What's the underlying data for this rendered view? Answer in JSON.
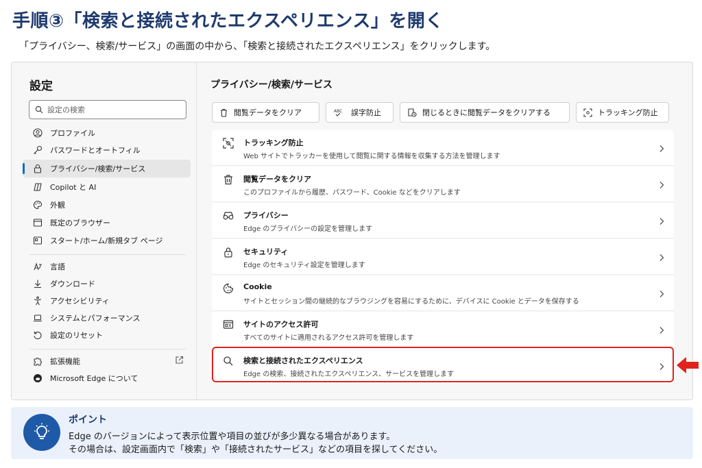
{
  "heading": {
    "title": "手順③「検索と接続されたエクスペリエンス」を開く",
    "subtitle": "「プライバシー、検索/サービス」の画面の中から、「検索と接続されたエクスペリエンス」をクリックします。"
  },
  "sidebar": {
    "title": "設定",
    "search_placeholder": "設定の検索",
    "items": [
      {
        "label": "プロファイル",
        "icon": "profile-icon"
      },
      {
        "label": "パスワードとオートフィル",
        "icon": "key-icon"
      },
      {
        "label": "プライバシー/検索/サービス",
        "icon": "lock-icon",
        "active": true
      },
      {
        "label": "Copilot と AI",
        "icon": "copilot-icon"
      },
      {
        "label": "外観",
        "icon": "palette-icon"
      },
      {
        "label": "既定のブラウザー",
        "icon": "browser-icon"
      },
      {
        "label": "スタート/ホーム/新規タブ ページ",
        "icon": "home-icon"
      },
      {
        "label": "言語",
        "icon": "language-icon"
      },
      {
        "label": "ダウンロード",
        "icon": "download-icon"
      },
      {
        "label": "アクセシビリティ",
        "icon": "accessibility-icon"
      },
      {
        "label": "システムとパフォーマンス",
        "icon": "laptop-icon"
      },
      {
        "label": "設定のリセット",
        "icon": "reset-icon"
      },
      {
        "label": "拡張機能",
        "icon": "puzzle-icon"
      },
      {
        "label": "Microsoft Edge について",
        "icon": "edge-icon"
      }
    ]
  },
  "main": {
    "title": "プライバシー/検索/サービス",
    "chips": [
      {
        "label": "閲覧データをクリア",
        "icon": "trash-icon"
      },
      {
        "label": "誤字防止",
        "icon": "spellcheck-icon"
      },
      {
        "label": "閉じるときに閲覧データをクリアする",
        "icon": "clear-on-close-icon"
      },
      {
        "label": "トラッキング防止",
        "icon": "tracking-icon"
      }
    ],
    "cards": [
      {
        "title": "トラッキング防止",
        "desc": "Web サイトでトラッカーを使用して閲覧に関する情報を収集する方法を管理します",
        "icon": "tracking-icon"
      },
      {
        "title": "閲覧データをクリア",
        "desc": "このプロファイルから履歴、パスワード、Cookie などをクリアします",
        "icon": "trash-icon"
      },
      {
        "title": "プライバシー",
        "desc": "Edge のプライバシーの設定を管理します",
        "icon": "glasses-icon"
      },
      {
        "title": "セキュリティ",
        "desc": "Edge のセキュリティ設定を管理します",
        "icon": "lock-icon"
      },
      {
        "title": "Cookie",
        "desc": "サイトとセッション間の継続的なブラウジングを容易にするために、デバイスに Cookie とデータを保存する",
        "icon": "cookie-icon"
      },
      {
        "title": "サイトのアクセス許可",
        "desc": "すべてのサイトに適用されるアクセス許可を管理します",
        "icon": "site-permissions-icon"
      },
      {
        "title": "検索と接続されたエクスペリエンス",
        "desc": "Edge の検索、接続されたエクスペリエンス、サービスを管理します",
        "icon": "search-icon"
      }
    ]
  },
  "tip": {
    "heading": "ポイント",
    "line1": "Edge のバージョンによって表示位置や項目の並びが多少異なる場合があります。",
    "line2": "その場合は、設定画面内で「検索」や「接続されたサービス」などの項目を探してください。"
  },
  "colors": {
    "title": "#1e3a6e",
    "accent": "#0f6cbd",
    "highlight": "#e0231c",
    "tip_bg": "#eaf1fb",
    "tip_icon": "#1e5aa8"
  }
}
